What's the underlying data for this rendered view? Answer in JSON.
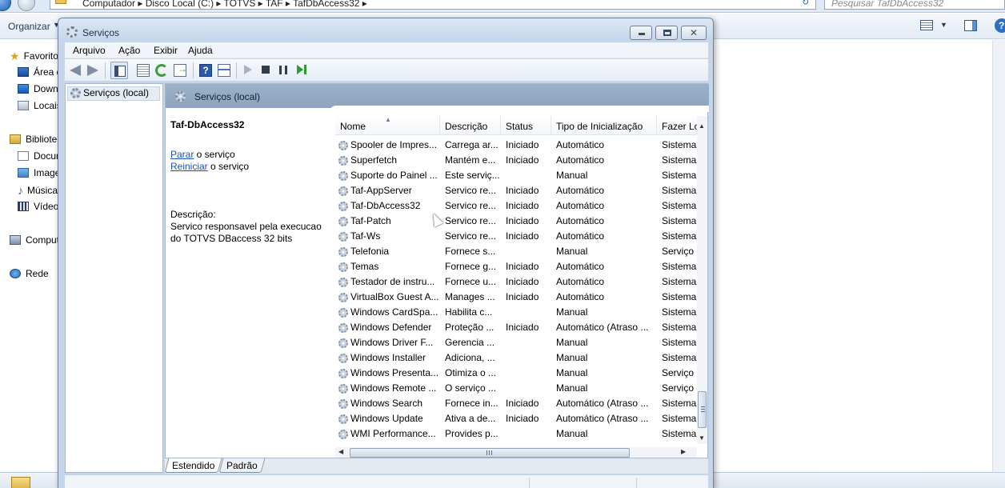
{
  "explorer": {
    "breadcrumb": "Computador  ▸  Disco Local (C:)  ▸  TOTVS  ▸  TAF  ▸  TafDbAccess32  ▸",
    "search_placeholder": "Pesquisar TafDbAccess32",
    "organize_label": "Organizar",
    "nav_items": [
      {
        "label": "Favoritos",
        "icon": "star-icon"
      },
      {
        "label": "Área de Trabalho",
        "icon": "desktop-icon"
      },
      {
        "label": "Downloads",
        "icon": "downloads-icon"
      },
      {
        "label": "Locais",
        "icon": "places-icon"
      },
      {
        "label": "Bibliotecas",
        "icon": "library-icon"
      },
      {
        "label": "Documentos",
        "icon": "documents-icon"
      },
      {
        "label": "Imagens",
        "icon": "pictures-icon"
      },
      {
        "label": "Músicas",
        "icon": "music-icon"
      },
      {
        "label": "Vídeos",
        "icon": "videos-icon"
      },
      {
        "label": "Computador",
        "icon": "computer-icon"
      },
      {
        "label": "Rede",
        "icon": "network-icon"
      }
    ]
  },
  "services_window": {
    "title": "Serviços",
    "menu": [
      "Arquivo",
      "Ação",
      "Exibir",
      "Ajuda"
    ],
    "tree_item": "Serviços (local)",
    "header_title": "Serviços (local)",
    "selected_service": {
      "name": "Taf-DbAccess32",
      "stop_link": "Parar",
      "stop_suffix": " o serviço",
      "restart_link": "Reiniciar",
      "restart_suffix": " o serviço",
      "description_label": "Descrição:",
      "description": "Servico responsavel pela execucao do TOTVS DBaccess 32 bits"
    },
    "columns": [
      "Nome",
      "Descrição",
      "Status",
      "Tipo de Inicialização",
      "Fazer Logon como"
    ],
    "rows": [
      {
        "name": "Spooler de Impres...",
        "desc": "Carrega ar...",
        "status": "Iniciado",
        "type": "Automático",
        "logon": "Sistema Local"
      },
      {
        "name": "Superfetch",
        "desc": "Mantém e...",
        "status": "Iniciado",
        "type": "Automático",
        "logon": "Sistema Local"
      },
      {
        "name": "Suporte do Painel ...",
        "desc": "Este serviç...",
        "status": "",
        "type": "Manual",
        "logon": "Sistema Local"
      },
      {
        "name": "Taf-AppServer",
        "desc": "Servico re...",
        "status": "Iniciado",
        "type": "Automático",
        "logon": "Sistema Local"
      },
      {
        "name": "Taf-DbAccess32",
        "desc": "Servico re...",
        "status": "Iniciado",
        "type": "Automático",
        "logon": "Sistema Local"
      },
      {
        "name": "Taf-Patch",
        "desc": "Servico re...",
        "status": "Iniciado",
        "type": "Automático",
        "logon": "Sistema Local"
      },
      {
        "name": "Taf-Ws",
        "desc": "Servico re...",
        "status": "Iniciado",
        "type": "Automático",
        "logon": "Sistema Local"
      },
      {
        "name": "Telefonia",
        "desc": "Fornece s...",
        "status": "",
        "type": "Manual",
        "logon": "Serviço de Rede"
      },
      {
        "name": "Temas",
        "desc": "Fornece g...",
        "status": "Iniciado",
        "type": "Automático",
        "logon": "Sistema Local"
      },
      {
        "name": "Testador de instru...",
        "desc": "Fornece u...",
        "status": "Iniciado",
        "type": "Automático",
        "logon": "Sistema Local"
      },
      {
        "name": "VirtualBox Guest A...",
        "desc": "Manages ...",
        "status": "Iniciado",
        "type": "Automático",
        "logon": "Sistema Local"
      },
      {
        "name": "Windows CardSpa...",
        "desc": "Habilita c...",
        "status": "",
        "type": "Manual",
        "logon": "Sistema Local"
      },
      {
        "name": "Windows Defender",
        "desc": "Proteção ...",
        "status": "Iniciado",
        "type": "Automático (Atraso ...",
        "logon": "Sistema Local"
      },
      {
        "name": "Windows Driver F...",
        "desc": "Gerencia ...",
        "status": "",
        "type": "Manual",
        "logon": "Sistema Local"
      },
      {
        "name": "Windows Installer",
        "desc": "Adiciona, ...",
        "status": "",
        "type": "Manual",
        "logon": "Sistema Local"
      },
      {
        "name": "Windows Presenta...",
        "desc": "Otimiza o ...",
        "status": "",
        "type": "Manual",
        "logon": "Serviço Local"
      },
      {
        "name": "Windows Remote ...",
        "desc": "O serviço ...",
        "status": "",
        "type": "Manual",
        "logon": "Serviço de Rede"
      },
      {
        "name": "Windows Search",
        "desc": "Fornece in...",
        "status": "Iniciado",
        "type": "Automático (Atraso ...",
        "logon": "Sistema Local"
      },
      {
        "name": "Windows Update",
        "desc": "Ativa a de...",
        "status": "Iniciado",
        "type": "Automático (Atraso ...",
        "logon": "Sistema Local"
      },
      {
        "name": "WMI Performance...",
        "desc": "Provides p...",
        "status": "",
        "type": "Manual",
        "logon": "Sistema Local"
      }
    ],
    "tabs": [
      "Estendido",
      "Padrão"
    ]
  }
}
